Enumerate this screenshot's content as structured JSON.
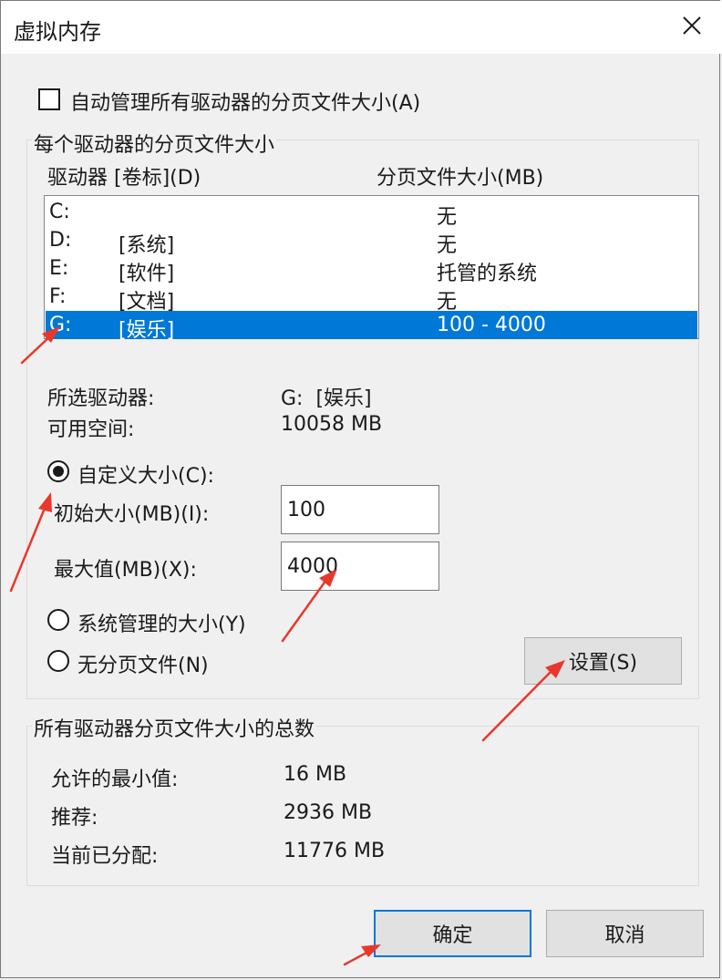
{
  "window": {
    "title": "虚拟内存",
    "close_icon": "close-icon"
  },
  "auto_manage": {
    "label": "自动管理所有驱动器的分页文件大小(A)",
    "checked": false
  },
  "per_drive": {
    "legend": "每个驱动器的分页文件大小",
    "col_drive": "驱动器 [卷标](D)",
    "col_size": "分页文件大小(MB)",
    "drives": [
      {
        "letter": "C:",
        "label": "",
        "size": "无",
        "selected": false
      },
      {
        "letter": "D:",
        "label": "[系统]",
        "size": "无",
        "selected": false
      },
      {
        "letter": "E:",
        "label": "[软件]",
        "size": "托管的系统",
        "selected": false
      },
      {
        "letter": "F:",
        "label": "[文档]",
        "size": "无",
        "selected": false
      },
      {
        "letter": "G:",
        "label": "[娱乐]",
        "size": "100 - 4000",
        "selected": true
      }
    ],
    "selected_drive_label": "所选驱动器:",
    "selected_drive_value": "G:  [娱乐]",
    "free_space_label": "可用空间:",
    "free_space_value": "10058 MB",
    "custom_size_label": "自定义大小(C):",
    "initial_label": "初始大小(MB)(I):",
    "initial_value": "100",
    "max_label": "最大值(MB)(X):",
    "max_value": "4000",
    "system_managed_label": "系统管理的大小(Y)",
    "no_paging_label": "无分页文件(N)",
    "set_button": "设置(S)",
    "selected_option": "custom"
  },
  "totals": {
    "legend": "所有驱动器分页文件大小的总数",
    "min_label": "允许的最小值:",
    "min_value": "16 MB",
    "recommended_label": "推荐:",
    "recommended_value": "2936 MB",
    "current_label": "当前已分配:",
    "current_value": "11776 MB"
  },
  "buttons": {
    "ok": "确定",
    "cancel": "取消"
  },
  "colors": {
    "selection": "#0078d7",
    "annotation_arrow": "#e8382c"
  }
}
